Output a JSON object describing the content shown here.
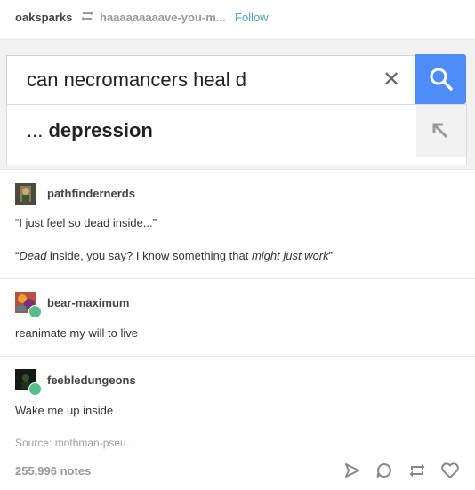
{
  "header": {
    "author": "oaksparks",
    "source_blog": "haaaaaaaaave-you-m...",
    "follow_label": "Follow"
  },
  "search": {
    "query": "can necromancers heal d",
    "suggestion_prefix": "...",
    "suggestion_bold": "depression"
  },
  "posts": [
    {
      "username": "pathfindernerds",
      "lines": [
        "“I just feel so dead inside...”"
      ],
      "reply_parts": [
        "“",
        "Dead",
        " inside, you say? I know something that ",
        "might just work",
        "”"
      ]
    },
    {
      "username": "bear-maximum",
      "text": "reanimate my will to live"
    },
    {
      "username": "feebledungeons",
      "text": "Wake me up inside"
    }
  ],
  "footer": {
    "source": "Source:  mothman-pseu...",
    "notes": "255,996 notes"
  },
  "colors": {
    "accent": "#529ecc",
    "search_button": "#4e8cf7",
    "reblog_badge": "#56bc8a"
  }
}
